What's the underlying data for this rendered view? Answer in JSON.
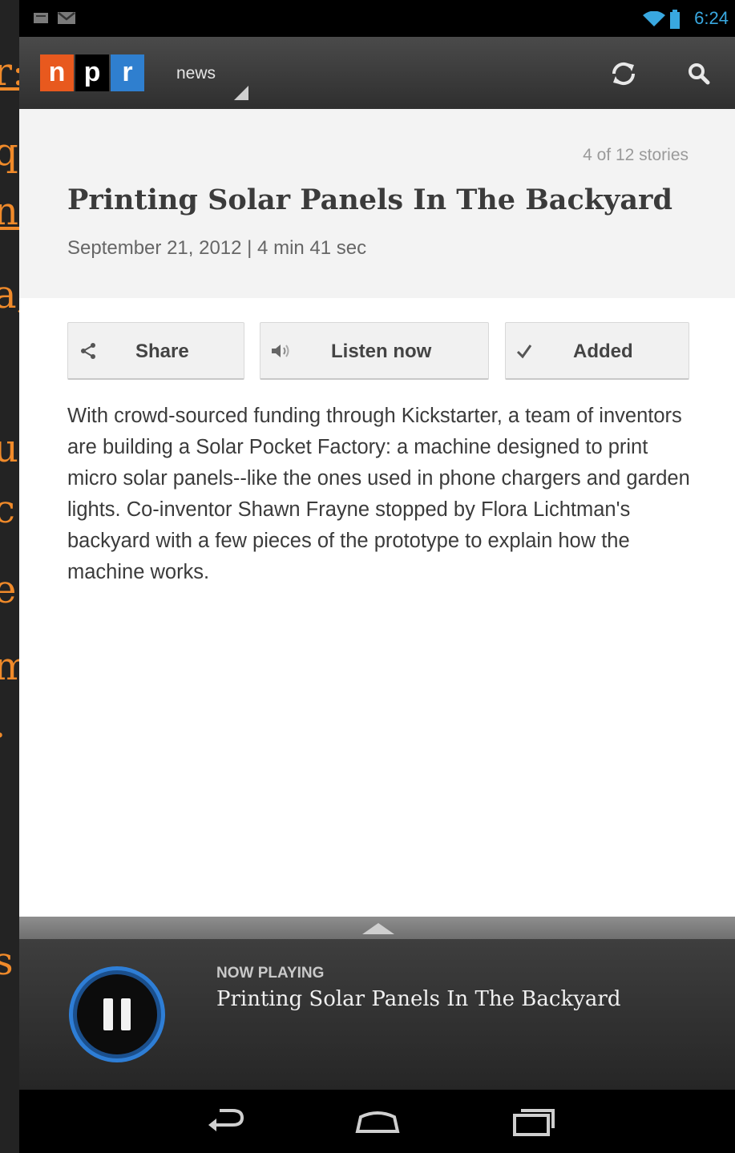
{
  "status_bar": {
    "time": "6:24"
  },
  "action_bar": {
    "logo_letters": [
      "n",
      "p",
      "r"
    ],
    "logo_colors": [
      "#e8591e",
      "#000000",
      "#2f7fcf"
    ],
    "section_label": "news",
    "icons": [
      "refresh-icon",
      "search-icon"
    ]
  },
  "story": {
    "count": "4 of 12 stories",
    "title": "Printing Solar Panels In The Backyard",
    "meta": "September 21, 2012 | 4 min 41 sec",
    "body": "With crowd-sourced funding through Kickstarter, a team of inventors are building a Solar Pocket Factory: a machine designed to print micro solar panels--like the ones used in phone chargers and garden lights. Co-inventor Shawn Frayne stopped by Flora Lichtman's backyard with a few pieces of the prototype to explain how the machine works."
  },
  "actions": {
    "share": "Share",
    "listen": "Listen now",
    "added": "Added"
  },
  "player": {
    "label": "NOW PLAYING",
    "title": "Printing Solar Panels In The Backyard",
    "state": "playing"
  },
  "background_text": [
    "r:",
    "q",
    "n!",
    "a,",
    "",
    "u",
    "c!",
    "e",
    "m",
    ".",
    "",
    "",
    "s"
  ],
  "colors": {
    "accent": "#f08a2a",
    "status_blue": "#39a8e0",
    "player_ring": "#2e7ed6"
  }
}
